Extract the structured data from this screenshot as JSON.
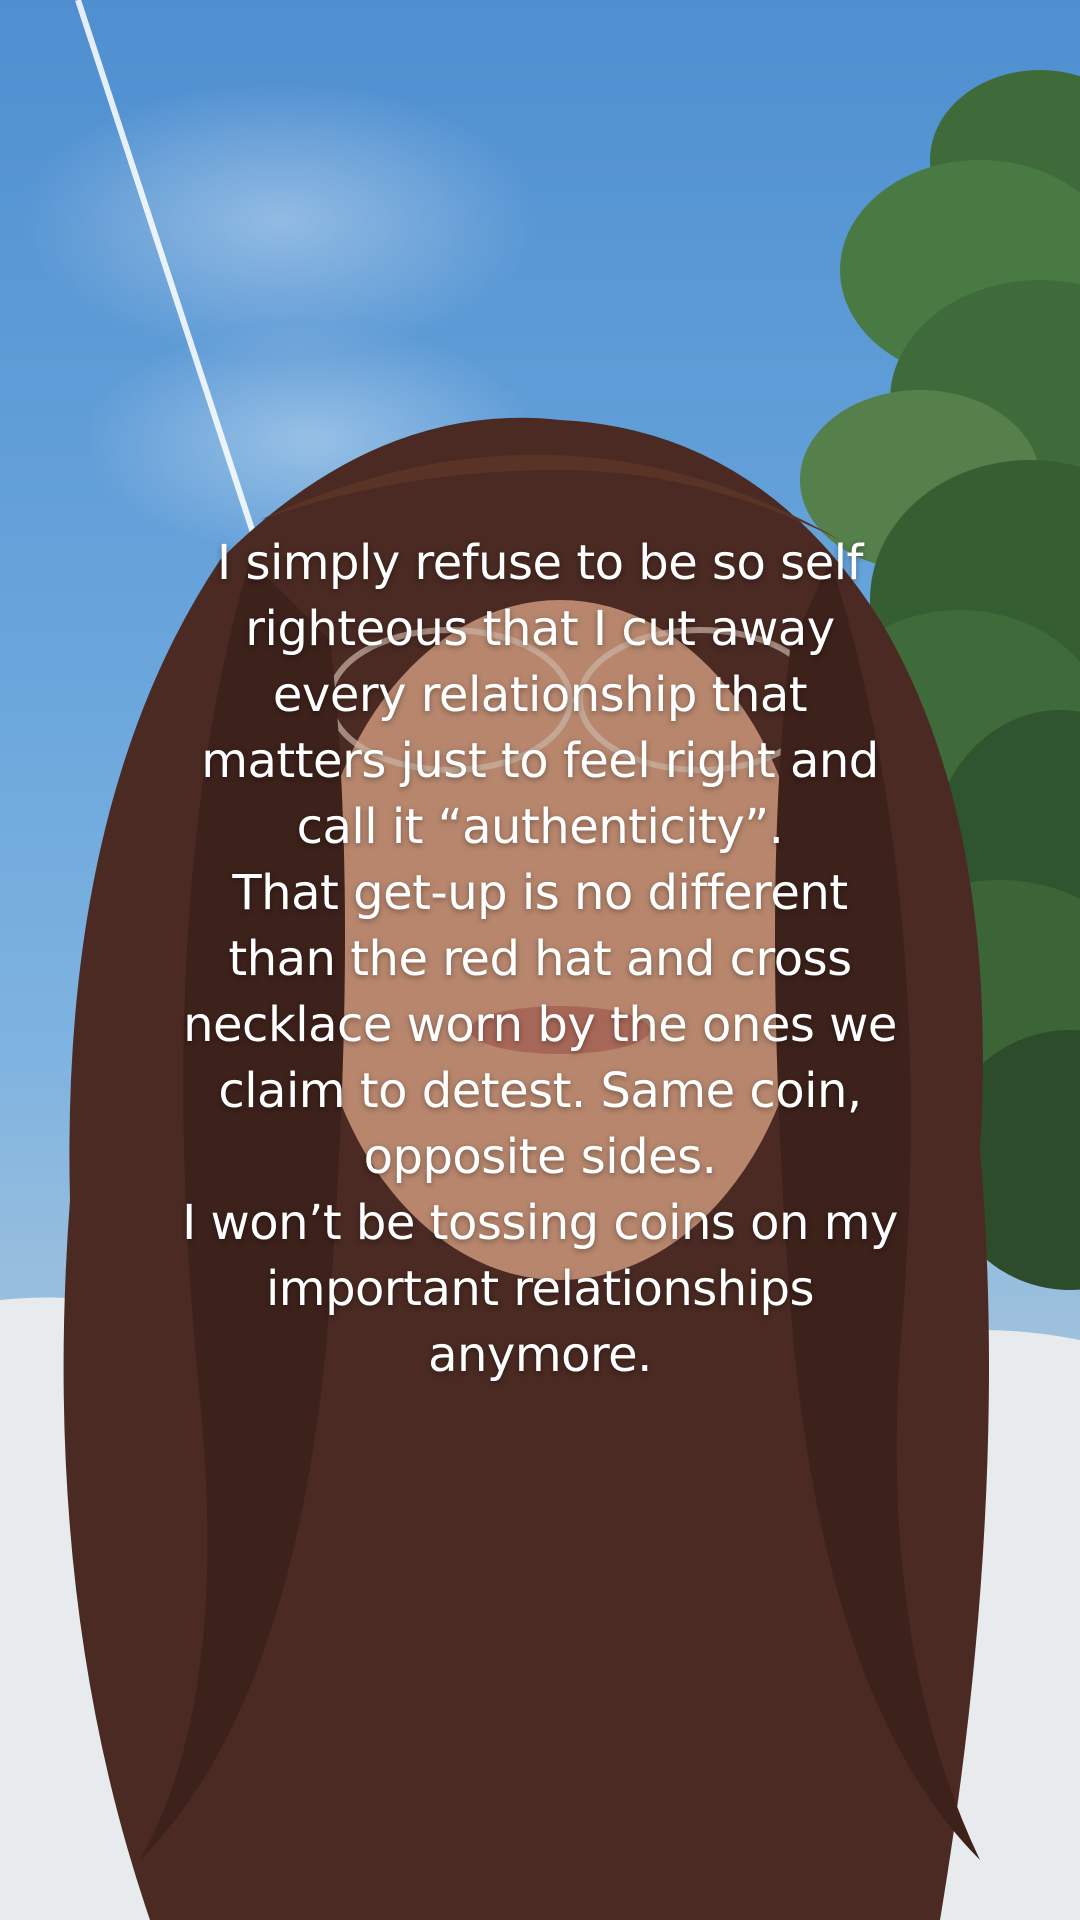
{
  "caption": {
    "lines": [
      "I simply refuse to be so self",
      "righteous that I cut away",
      "every relationship that",
      "matters just to feel right and",
      "call it “authenticity”.",
      "That get-up is no different",
      "than the red hat and cross",
      "necklace worn by the ones we",
      "claim to detest. Same coin,",
      "opposite sides.",
      "I won’t be tossing coins on my",
      "important relationships",
      "anymore."
    ]
  },
  "scene": {
    "sky_color": "#5e9bd6",
    "foliage_color": "#3f6b3a",
    "hair_color": "#4a2a22",
    "shirt_color": "#e8ebee"
  }
}
